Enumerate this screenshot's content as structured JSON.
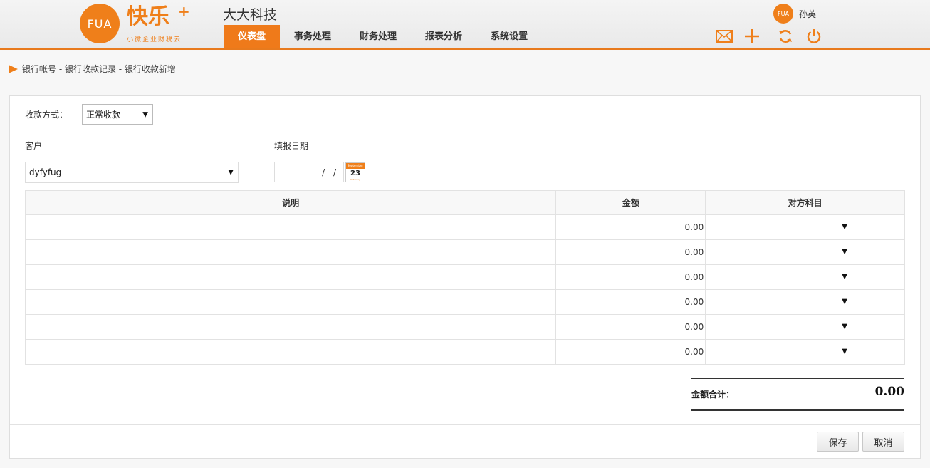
{
  "header": {
    "logo_mark": "FUA",
    "logo_text": "快乐",
    "logo_plus": "+",
    "logo_slogan": "小微企业财税云",
    "company": "大大科技",
    "nav": [
      {
        "label": "仪表盘",
        "active": true
      },
      {
        "label": "事务处理",
        "active": false
      },
      {
        "label": "财务处理",
        "active": false
      },
      {
        "label": "报表分析",
        "active": false
      },
      {
        "label": "系统设置",
        "active": false
      }
    ],
    "user_avatar": "FUA",
    "user_name": "孙英",
    "icons": [
      "mail-icon",
      "plus-icon",
      "refresh-icon",
      "power-icon"
    ],
    "accent": "#ef7f1a"
  },
  "breadcrumb": "银行帐号 - 银行收款记录 - 银行收款新增",
  "form": {
    "payment_method_label": "收款方式：",
    "payment_method_value": "正常收款",
    "customer_label": "客户",
    "customer_value": "dyfyfug",
    "date_label": "填报日期",
    "date_value": "/ /",
    "calendar": {
      "month": "September",
      "day": "23",
      "weekday": "Saturday"
    }
  },
  "table": {
    "headers": [
      "说明",
      "金额",
      "对方科目"
    ],
    "rows": [
      {
        "desc": "",
        "amount": "0.00",
        "account": ""
      },
      {
        "desc": "",
        "amount": "0.00",
        "account": ""
      },
      {
        "desc": "",
        "amount": "0.00",
        "account": ""
      },
      {
        "desc": "",
        "amount": "0.00",
        "account": ""
      },
      {
        "desc": "",
        "amount": "0.00",
        "account": ""
      },
      {
        "desc": "",
        "amount": "0.00",
        "account": ""
      }
    ]
  },
  "total": {
    "label": "金额合计：",
    "value": "0.00"
  },
  "buttons": {
    "save": "保存",
    "cancel": "取消"
  }
}
